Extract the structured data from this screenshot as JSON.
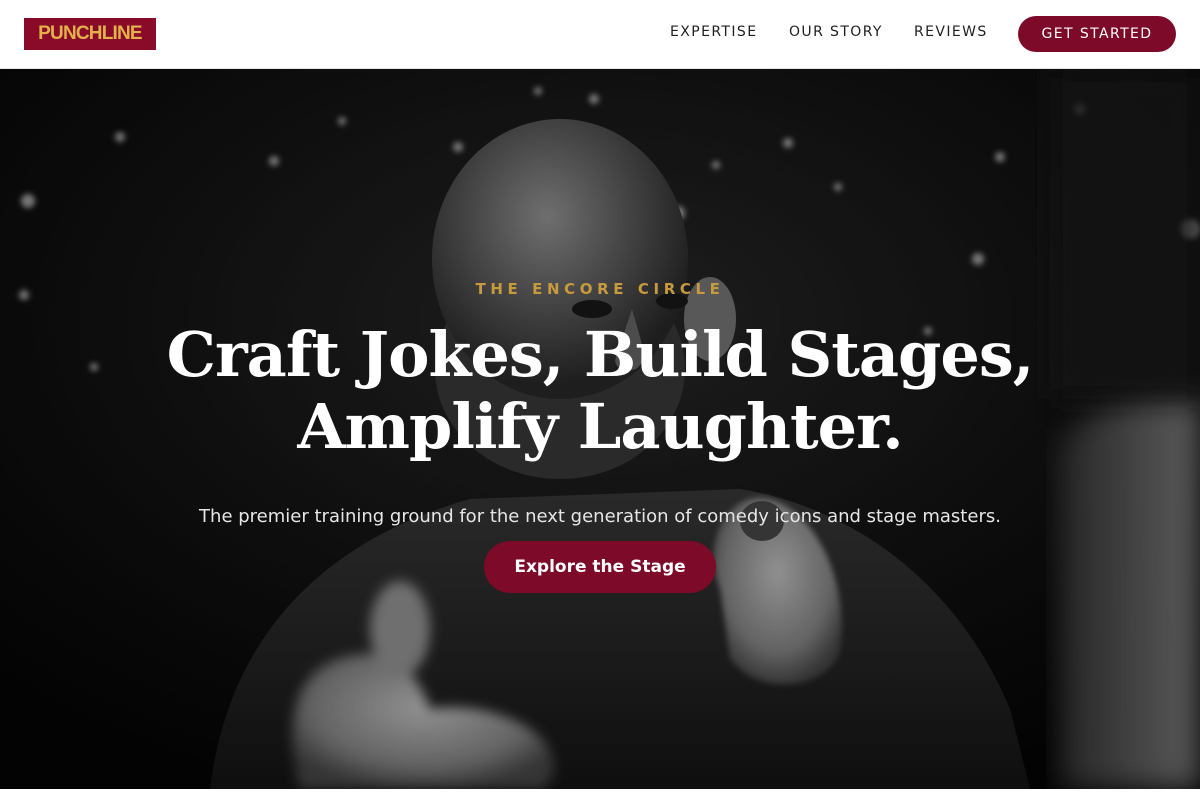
{
  "header": {
    "logo_text": "PUNCHLINE",
    "nav_items": [
      {
        "label": "EXPERTISE"
      },
      {
        "label": "OUR STORY"
      },
      {
        "label": "REVIEWS"
      }
    ],
    "cta_label": "GET STARTED"
  },
  "hero": {
    "eyebrow": "THE ENCORE CIRCLE",
    "headline_line1": "Craft Jokes, Build Stages,",
    "headline_line2": "Amplify Laughter.",
    "subtitle": "The premier training ground for the next generation of comedy icons and stage masters.",
    "cta_label": "Explore the Stage"
  },
  "colors": {
    "brand_primary": "#7c0a28",
    "brand_accent": "#c99a3c",
    "logo_text": "#e2b14a",
    "header_background": "#ffffff",
    "hero_text": "#ffffff"
  }
}
